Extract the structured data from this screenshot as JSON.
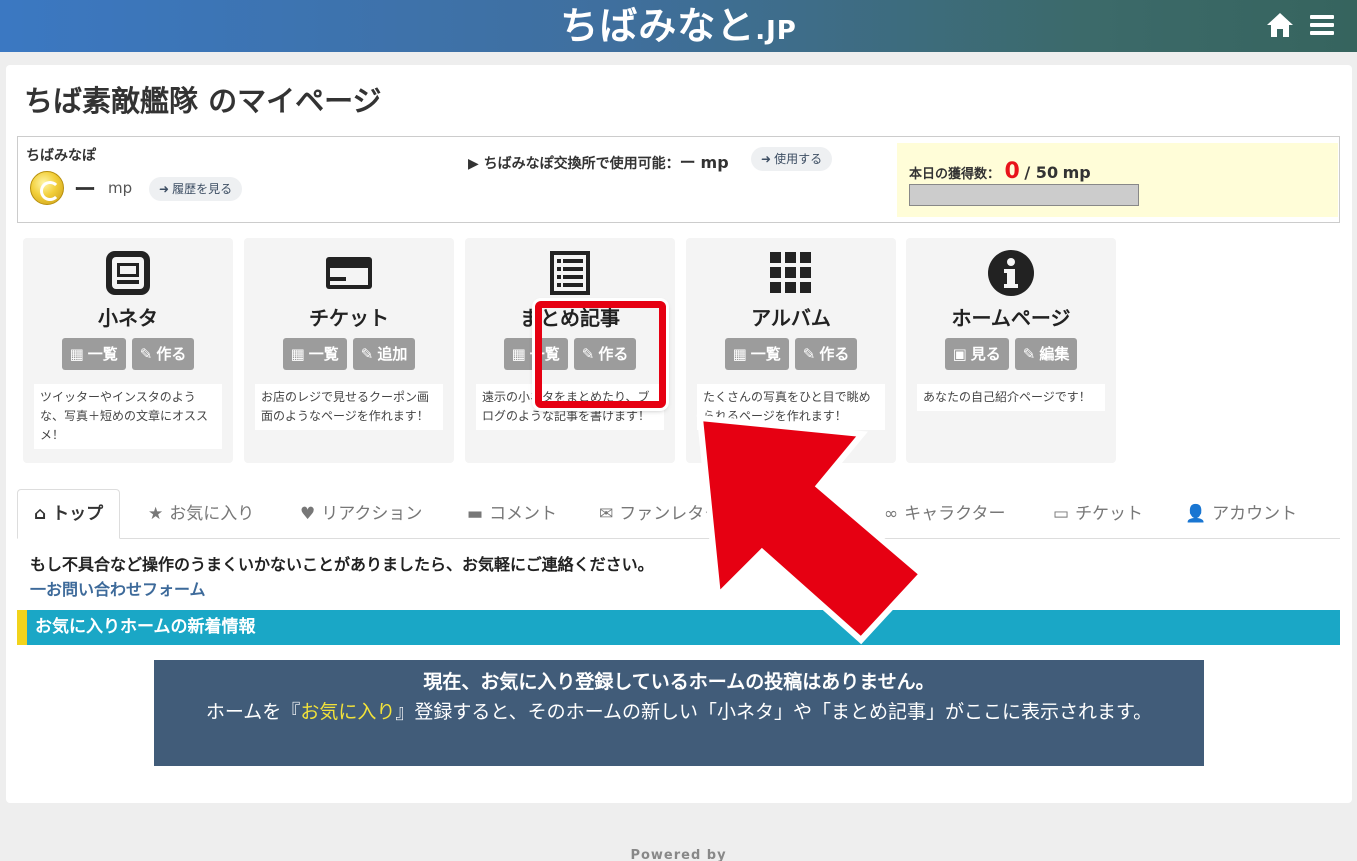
{
  "header": {
    "logo_main": "ちばみなと",
    "logo_suffix": ".JP",
    "home_icon": "home-icon",
    "menu_icon": "hamburger-menu-icon"
  },
  "page": {
    "title": "ちば素敵艦隊 のマイページ"
  },
  "points": {
    "label": "ちばみなぽ",
    "balance": "ー",
    "unit": "mp",
    "history_link": "履歴を見る",
    "exchange_prefix": "▶ ちばみなぽ交換所で使用可能：",
    "exchange_value": "ー",
    "exchange_unit": "mp",
    "use_link": "使用する",
    "today_label": "本日の獲得数：",
    "today_value": "0",
    "today_max": "/ 50",
    "today_unit": "mp",
    "today_progress": 0
  },
  "tiles": [
    {
      "icon": "mobile-icon",
      "name": "小ネタ",
      "btn1": "一覧",
      "btn1_icon": "grid-icon",
      "btn2": "作る",
      "btn2_icon": "edit-icon",
      "desc": "ツイッターやインスタのような、写真＋短めの文章にオススメ！"
    },
    {
      "icon": "ticket-card-icon",
      "name": "チケット",
      "btn1": "一覧",
      "btn1_icon": "grid-icon",
      "btn2": "追加",
      "btn2_icon": "edit-icon",
      "desc": "お店のレジで見せるクーポン画面のようなページを作れます！"
    },
    {
      "icon": "article-list-icon",
      "name": "まとめ記事",
      "btn1": "一覧",
      "btn1_icon": "grid-icon",
      "btn2": "作る",
      "btn2_icon": "edit-icon",
      "desc": "遠示の小ネタをまとめたり、ブログのような記事を書けます！"
    },
    {
      "icon": "album-grid-icon",
      "name": "アルバム",
      "btn1": "一覧",
      "btn1_icon": "grid-icon",
      "btn2": "作る",
      "btn2_icon": "edit-icon",
      "desc": "たくさんの写真をひと目で眺められるページを作れます！"
    },
    {
      "icon": "info-icon",
      "name": "ホームページ",
      "btn1": "見る",
      "btn1_icon": "image-icon",
      "btn2": "編集",
      "btn2_icon": "edit-icon",
      "desc": "あなたの自己紹介ページです！"
    }
  ],
  "tabs": [
    {
      "label": "トップ",
      "icon": "home-icon"
    },
    {
      "label": "お気に入り",
      "icon": "star-icon"
    },
    {
      "label": "リアクション",
      "icon": "heart-icon"
    },
    {
      "label": "コメント",
      "icon": "comment-icon"
    },
    {
      "label": "ファンレター",
      "icon": "envelope-icon"
    },
    {
      "label": "キャラクター",
      "icon": "glasses-icon"
    },
    {
      "label": "チケット",
      "icon": "ticket-icon"
    },
    {
      "label": "アカウント",
      "icon": "user-icon"
    }
  ],
  "notice": {
    "text": "もし不具合など操作のうまくいかないことがありましたら、お気軽にご連絡ください。",
    "link": "一お問い合わせフォーム"
  },
  "news": {
    "heading": "お気に入りホームの新着情報",
    "empty_title": "現在、お気に入り登録しているホームの投稿はありません。",
    "empty_pre": "ホームを『",
    "empty_highlight": "お気に入り",
    "empty_post": "』登録すると、そのホームの新しい「小ネタ」や「まとめ記事」がここに表示されます。"
  },
  "footer": {
    "powered": "Powered by"
  },
  "colors": {
    "accent_red": "#e60012",
    "news_bar": "#1aa7c6",
    "empty_box": "#415c79",
    "highlight_yellow": "#f2e23a"
  }
}
